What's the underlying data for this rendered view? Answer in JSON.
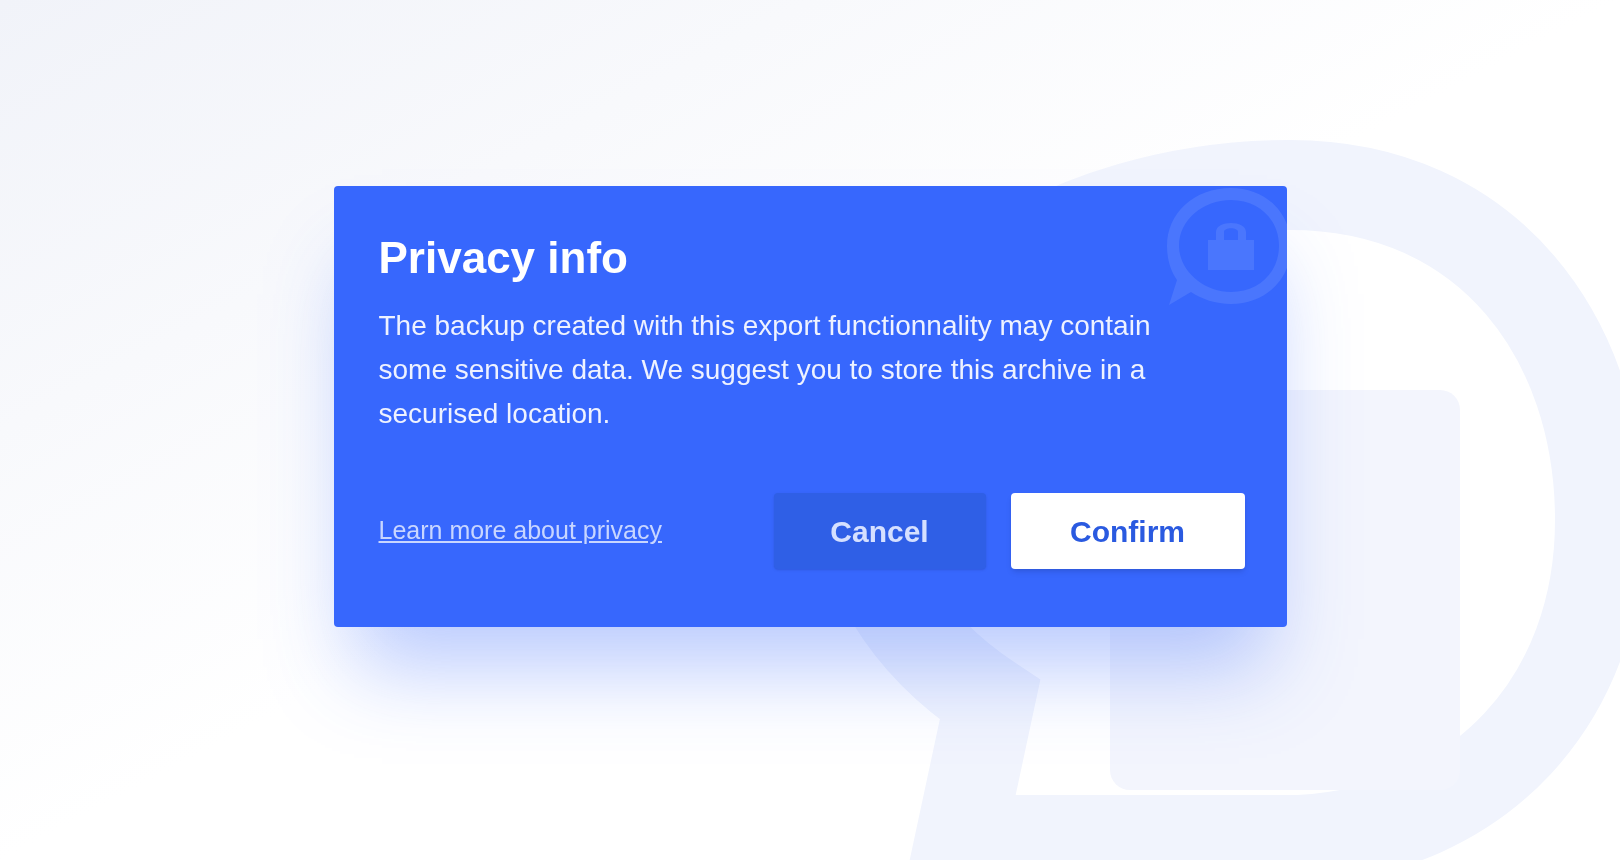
{
  "dialog": {
    "title": "Privacy info",
    "body": "The backup created with this export functionnality may contain some sensitive data. We suggest you to store this archive in a securised location.",
    "link": "Learn more about privacy",
    "buttons": [
      {
        "label": "Cancel",
        "kind": "secondary"
      },
      {
        "label": "Confirm",
        "kind": "primary"
      }
    ]
  }
}
